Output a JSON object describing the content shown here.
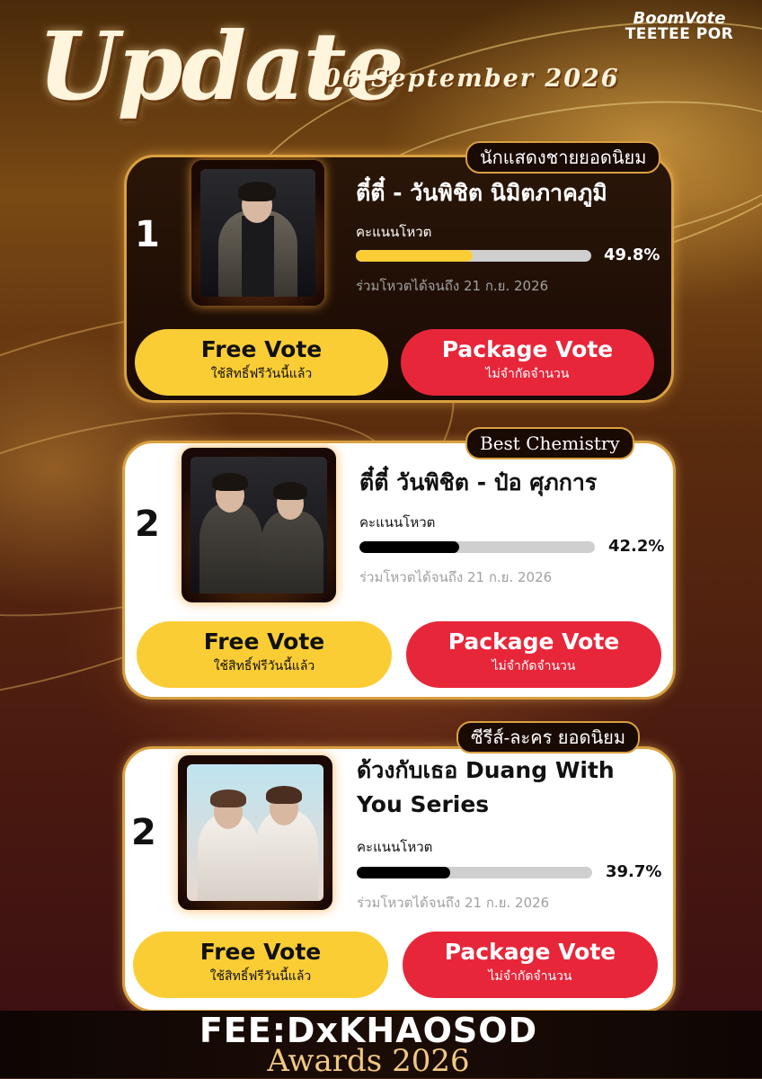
{
  "header": {
    "logo_line1": "BoomVote",
    "logo_line2": "TEETEE POR",
    "title": "Update",
    "date": "06 September 2026"
  },
  "cards": [
    {
      "category": "นักแสดงชายยอดนิยม",
      "rank": "1",
      "name": "ตี๋ตี๋ - วันพิชิต นิมิตภาคภูมิ",
      "vote_label": "คะแนนโหวต",
      "percent_text": "49.8%",
      "percent": 49.8,
      "deadline": "ร่วมโหวตได้จนถึง 21 ก.ย. 2026",
      "free_vote": {
        "label": "Free Vote",
        "sub": "ใช้สิทธิ์ฟรีวันนี้แล้ว"
      },
      "package_vote": {
        "label": "Package Vote",
        "sub": "ไม่จำกัดจำนวน"
      }
    },
    {
      "category": "Best Chemistry",
      "rank": "2",
      "name": "ตี๋ตี๋ วันพิชิต - ป๋อ ศุภการ",
      "vote_label": "คะแนนโหวต",
      "percent_text": "42.2%",
      "percent": 42.2,
      "deadline": "ร่วมโหวตได้จนถึง 21 ก.ย. 2026",
      "free_vote": {
        "label": "Free Vote",
        "sub": "ใช้สิทธิ์ฟรีวันนี้แล้ว"
      },
      "package_vote": {
        "label": "Package Vote",
        "sub": "ไม่จำกัดจำนวน"
      }
    },
    {
      "category": "ซีรีส์-ละคร ยอดนิยม",
      "rank": "2",
      "name": "ด้วงกับเธอ Duang With You Series",
      "vote_label": "คะแนนโหวต",
      "percent_text": "39.7%",
      "percent": 39.7,
      "deadline": "ร่วมโหวตได้จนถึง 21 ก.ย. 2026",
      "free_vote": {
        "label": "Free Vote",
        "sub": "ใช้สิทธิ์ฟรีวันนี้แล้ว"
      },
      "package_vote": {
        "label": "Package Vote",
        "sub": "ไม่จำกัดจำนวน"
      }
    }
  ],
  "footer": {
    "line1": "FEE:DxKHAOSOD",
    "line2": "Awards 2026"
  },
  "colors": {
    "gold_border": "#d8a040",
    "free_button": "#fbcd35",
    "package_button": "#e8263a",
    "bar_fill_card1": "#fbcd35",
    "bar_fill_others": "#000000"
  }
}
